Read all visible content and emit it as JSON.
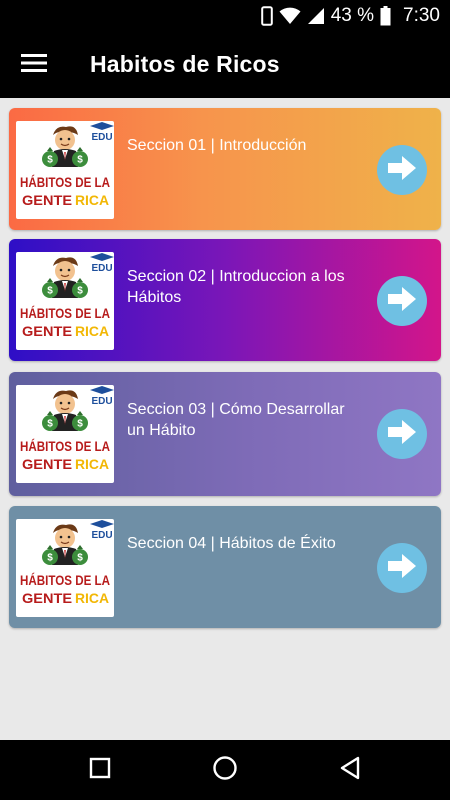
{
  "status_bar": {
    "battery_percent": "43 %",
    "time": "7:30",
    "icons": [
      "phone-outline-icon",
      "wifi-icon",
      "cell-signal-icon",
      "battery-icon"
    ]
  },
  "app_bar": {
    "title": "Habitos de Ricos",
    "menu_icon": "hamburger-menu-icon"
  },
  "thumbnail": {
    "line1": "HÁBITOS DE LA",
    "line2a": "GENTE",
    "line2b": "RICA",
    "badge": "EDU"
  },
  "sections": [
    {
      "title": "Seccion 01 | Introducción",
      "arrow_icon": "arrow-right-icon"
    },
    {
      "title": "Seccion 02 | Introduccion a los Hábitos",
      "arrow_icon": "arrow-right-icon"
    },
    {
      "title": "Seccion 03 | Cómo Desarrollar un Hábito",
      "arrow_icon": "arrow-right-icon"
    },
    {
      "title": "Seccion 04 | Hábitos de Éxito",
      "arrow_icon": "arrow-right-icon"
    }
  ],
  "nav_bar": {
    "icons": [
      "recents-square-icon",
      "home-circle-icon",
      "back-triangle-icon"
    ]
  },
  "colors": {
    "card1": "#f7944c",
    "card2": "#7a16b8",
    "card3": "#7e6bb7",
    "card4": "#6f8fa6",
    "arrow_circle": "#6fc0e3",
    "thumb_red": "#b71c1c",
    "thumb_gold": "#f2b705"
  }
}
